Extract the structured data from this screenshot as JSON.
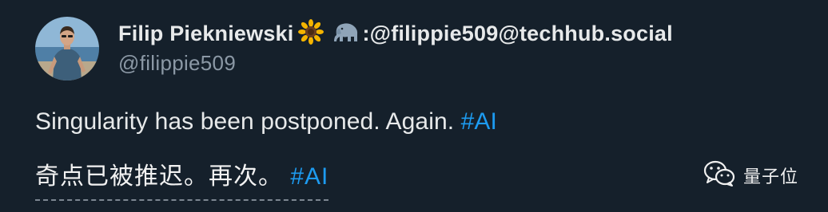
{
  "tweet": {
    "author": {
      "display_name": "Filip Piekniewski",
      "emoji_flower": "sunflower-icon",
      "emoji_animal": "elephant-icon",
      "mastodon": ":@filippie509@techhub.social",
      "handle": "@filippie509"
    },
    "text_en": "Singularity has been postponed. Again. ",
    "hashtag_en": "#AI",
    "translation_zh": "奇点已被推迟。再次。 ",
    "hashtag_zh": "#AI"
  },
  "watermark": {
    "icon": "wechat-icon",
    "label": "量子位"
  },
  "colors": {
    "background": "#15202b",
    "primary_text": "#e7e9ea",
    "secondary_text": "#8b98a5",
    "link": "#1d9bf0"
  }
}
